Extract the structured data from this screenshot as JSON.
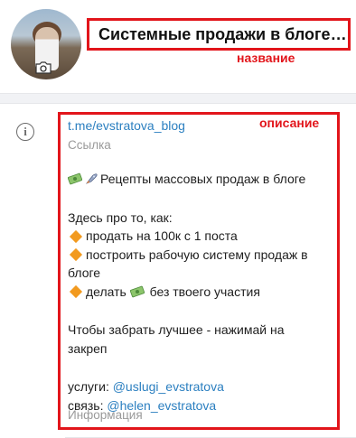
{
  "header": {
    "title": "Системные продажи в блоге |...",
    "title_annotation": "название"
  },
  "description": {
    "annotation": "описание",
    "link": "t.me/evstratova_blog",
    "link_label": "Ссылка",
    "tagline": "Рецепты массовых продаж в блоге",
    "intro": "Здесь про то, как:",
    "bullets": [
      "продать на 100к с 1 поста",
      "построить рабочую систему продаж в",
      "блоге",
      "делать",
      "без твоего участия"
    ],
    "cta_line1": "Чтобы забрать лучшее - нажимай на",
    "cta_line2": "закреп",
    "services_label": "услуги:",
    "services_handle": "@uslugi_evstratova",
    "contact_label": "связь:",
    "contact_handle": "@helen_evstratova",
    "info_label": "Информация"
  },
  "colors": {
    "accent_red": "#e2151b",
    "link_blue": "#2b7fc0",
    "bullet_orange": "#f29a1f"
  },
  "icons": [
    "avatar",
    "camera-icon",
    "info-icon",
    "money-icon",
    "rocket-icon",
    "orange-diamond-icon"
  ]
}
